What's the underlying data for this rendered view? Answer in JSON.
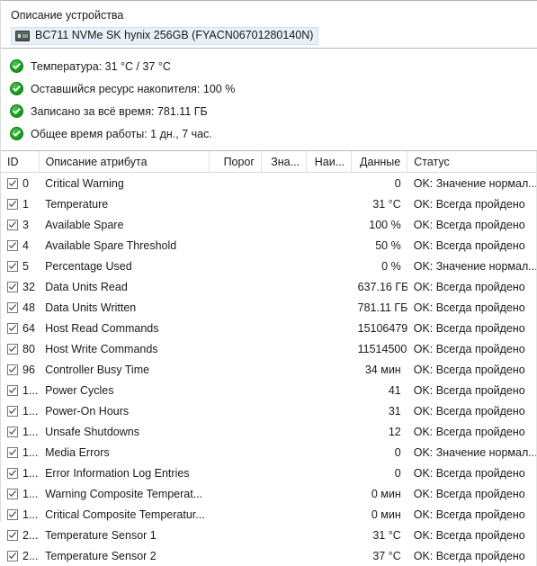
{
  "device": {
    "section_title": "Описание устройства",
    "icon": "hard-disk-icon",
    "name": "BC711 NVMe SK hynix 256GB (FYACN06701280140N)"
  },
  "status": {
    "icon": "ok-check-circle-icon",
    "items": [
      {
        "label": "Температура: 31 °C / 37 °C"
      },
      {
        "label": "Оставшийся ресурс накопителя: 100 %"
      },
      {
        "label": "Записано за всё время: 781.11 ГБ"
      },
      {
        "label": "Общее время работы: 1 дн., 7 час."
      }
    ]
  },
  "table": {
    "columns": [
      {
        "key": "id",
        "label": "ID",
        "align": "left"
      },
      {
        "key": "name",
        "label": "Описание атрибута",
        "align": "left"
      },
      {
        "key": "threshold",
        "label": "Порог",
        "align": "right"
      },
      {
        "key": "value",
        "label": "Зна...",
        "align": "right"
      },
      {
        "key": "worst",
        "label": "Наи...",
        "align": "right"
      },
      {
        "key": "raw",
        "label": "Данные",
        "align": "right"
      },
      {
        "key": "status",
        "label": "Статус",
        "align": "left"
      }
    ],
    "rows": [
      {
        "checked": true,
        "id": "0",
        "name": "Critical Warning",
        "threshold": "",
        "value": "",
        "worst": "",
        "raw": "0",
        "status": "OK: Значение нормал..."
      },
      {
        "checked": true,
        "id": "1",
        "name": "Temperature",
        "threshold": "",
        "value": "",
        "worst": "",
        "raw": "31 °C",
        "status": "OK: Всегда пройдено"
      },
      {
        "checked": true,
        "id": "3",
        "name": "Available Spare",
        "threshold": "",
        "value": "",
        "worst": "",
        "raw": "100 %",
        "status": "OK: Всегда пройдено"
      },
      {
        "checked": true,
        "id": "4",
        "name": "Available Spare Threshold",
        "threshold": "",
        "value": "",
        "worst": "",
        "raw": "50 %",
        "status": "OK: Всегда пройдено"
      },
      {
        "checked": true,
        "id": "5",
        "name": "Percentage Used",
        "threshold": "",
        "value": "",
        "worst": "",
        "raw": "0 %",
        "status": "OK: Значение нормал..."
      },
      {
        "checked": true,
        "id": "32",
        "name": "Data Units Read",
        "threshold": "",
        "value": "",
        "worst": "",
        "raw": "637.16 ГБ",
        "status": "OK: Всегда пройдено"
      },
      {
        "checked": true,
        "id": "48",
        "name": "Data Units Written",
        "threshold": "",
        "value": "",
        "worst": "",
        "raw": "781.11 ГБ",
        "status": "OK: Всегда пройдено"
      },
      {
        "checked": true,
        "id": "64",
        "name": "Host Read Commands",
        "threshold": "",
        "value": "",
        "worst": "",
        "raw": "15106479",
        "status": "OK: Всегда пройдено"
      },
      {
        "checked": true,
        "id": "80",
        "name": "Host Write Commands",
        "threshold": "",
        "value": "",
        "worst": "",
        "raw": "11514500",
        "status": "OK: Всегда пройдено"
      },
      {
        "checked": true,
        "id": "96",
        "name": "Controller Busy Time",
        "threshold": "",
        "value": "",
        "worst": "",
        "raw": "34 мин",
        "status": "OK: Всегда пройдено"
      },
      {
        "checked": true,
        "id": "1...",
        "name": "Power Cycles",
        "threshold": "",
        "value": "",
        "worst": "",
        "raw": "41",
        "status": "OK: Всегда пройдено"
      },
      {
        "checked": true,
        "id": "1...",
        "name": "Power-On Hours",
        "threshold": "",
        "value": "",
        "worst": "",
        "raw": "31",
        "status": "OK: Всегда пройдено"
      },
      {
        "checked": true,
        "id": "1...",
        "name": "Unsafe Shutdowns",
        "threshold": "",
        "value": "",
        "worst": "",
        "raw": "12",
        "status": "OK: Всегда пройдено"
      },
      {
        "checked": true,
        "id": "1...",
        "name": "Media Errors",
        "threshold": "",
        "value": "",
        "worst": "",
        "raw": "0",
        "status": "OK: Значение нормал..."
      },
      {
        "checked": true,
        "id": "1...",
        "name": "Error Information Log Entries",
        "threshold": "",
        "value": "",
        "worst": "",
        "raw": "0",
        "status": "OK: Всегда пройдено"
      },
      {
        "checked": true,
        "id": "1...",
        "name": "Warning Composite Temperat...",
        "threshold": "",
        "value": "",
        "worst": "",
        "raw": "0 мин",
        "status": "OK: Всегда пройдено"
      },
      {
        "checked": true,
        "id": "1...",
        "name": "Critical Composite Temperatur...",
        "threshold": "",
        "value": "",
        "worst": "",
        "raw": "0 мин",
        "status": "OK: Всегда пройдено"
      },
      {
        "checked": true,
        "id": "2...",
        "name": "Temperature Sensor 1",
        "threshold": "",
        "value": "",
        "worst": "",
        "raw": "31 °C",
        "status": "OK: Всегда пройдено"
      },
      {
        "checked": true,
        "id": "2...",
        "name": "Temperature Sensor 2",
        "threshold": "",
        "value": "",
        "worst": "",
        "raw": "37 °C",
        "status": "OK: Всегда пройдено"
      }
    ]
  },
  "colors": {
    "ok_green": "#17a11f",
    "chip_background": "#e8f0f9",
    "separator": "#b9b9b9",
    "text": "#1a1a1a"
  }
}
